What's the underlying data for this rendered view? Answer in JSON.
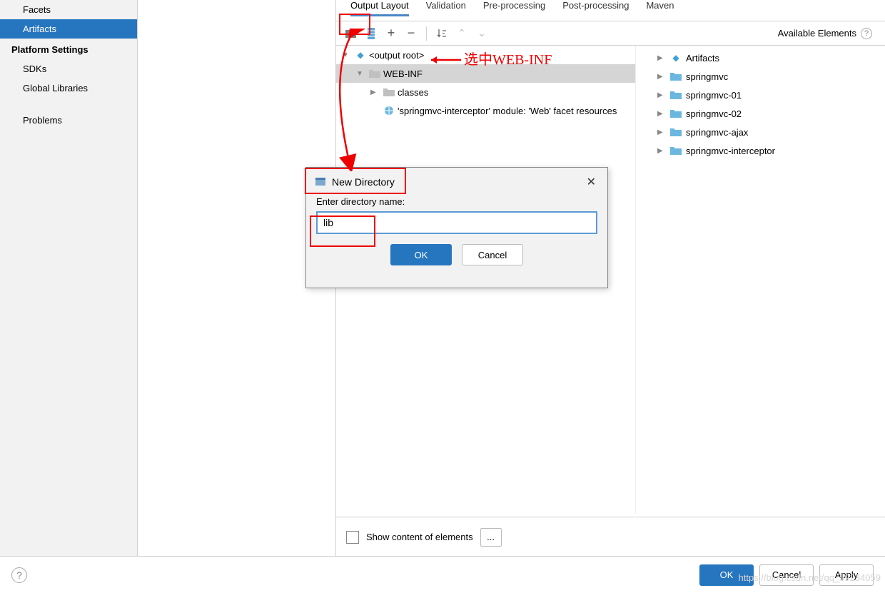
{
  "sidebar": {
    "items": [
      {
        "label": "Facets"
      },
      {
        "label": "Artifacts"
      }
    ],
    "platform_heading": "Platform Settings",
    "platform_items": [
      {
        "label": "SDKs"
      },
      {
        "label": "Global Libraries"
      }
    ],
    "problems": "Problems"
  },
  "tabs": [
    {
      "label": "Output Layout",
      "active": true
    },
    {
      "label": "Validation"
    },
    {
      "label": "Pre-processing"
    },
    {
      "label": "Post-processing"
    },
    {
      "label": "Maven"
    }
  ],
  "toolbar": {
    "available_label": "Available Elements"
  },
  "tree": {
    "output_root": "<output root>",
    "web_inf": "WEB-INF",
    "classes": "classes",
    "facet": "'springmvc-interceptor' module: 'Web' facet resources"
  },
  "elements": [
    "Artifacts",
    "springmvc",
    "springmvc-01",
    "springmvc-02",
    "springmvc-ajax",
    "springmvc-interceptor"
  ],
  "bottom": {
    "show_content": "Show content of elements",
    "ellipsis": "..."
  },
  "dialog": {
    "title": "New Directory",
    "label": "Enter directory name:",
    "value": "lib",
    "ok": "OK",
    "cancel": "Cancel"
  },
  "footer": {
    "ok": "OK",
    "cancel": "Cancel",
    "apply": "Apply"
  },
  "annotation": {
    "select_web_inf": "选中WEB-INF"
  },
  "watermark": "https://blog.csdn.net/qq_59234059"
}
